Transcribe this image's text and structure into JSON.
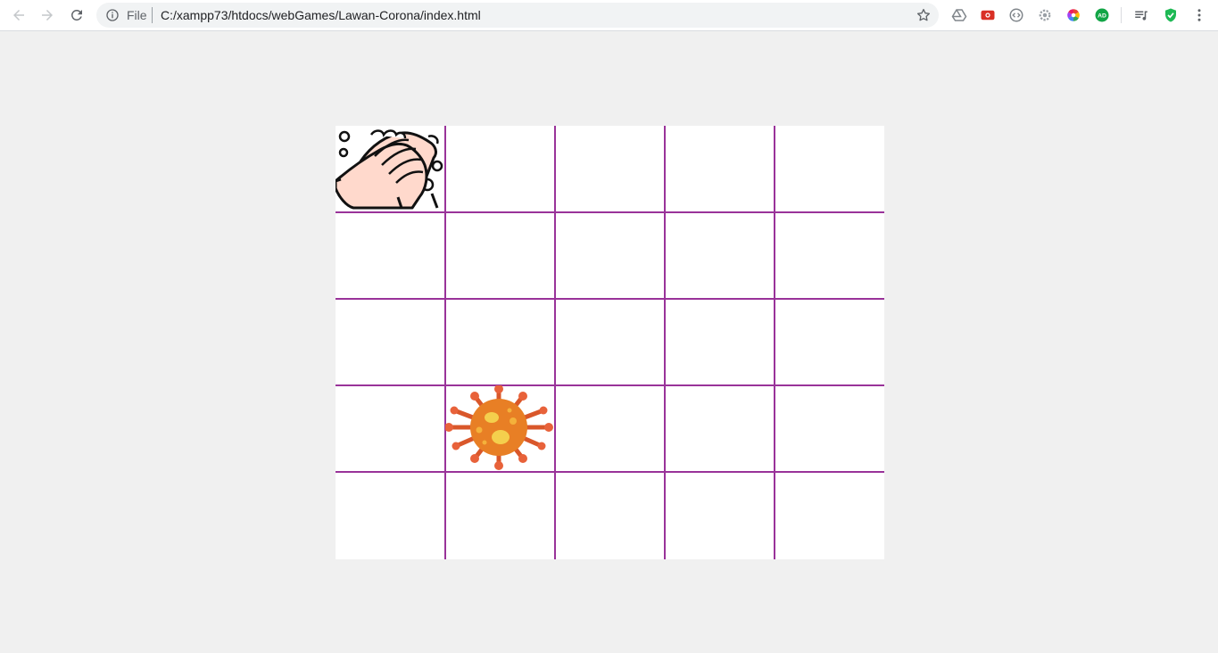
{
  "browser": {
    "scheme_label": "File",
    "url": "C:/xampp73/htdocs/webGames/Lawan-Corona/index.html",
    "icons": {
      "back": "back-arrow-icon",
      "forward": "forward-arrow-icon",
      "reload": "reload-icon",
      "info": "info-icon",
      "bookmark": "star-icon",
      "menu": "three-dot-menu-icon"
    },
    "extensions": [
      "drive-extension-icon",
      "red-extension-icon",
      "code-extension-icon",
      "gear-extension-icon",
      "color-wheel-extension-icon",
      "adguard-extension-icon",
      "playlist-extension-icon",
      "shield-check-extension-icon"
    ],
    "extension_badge_ad": "AD"
  },
  "game": {
    "rows": 5,
    "cols": 5,
    "grid_color": "#993399",
    "player": {
      "name": "hand-washing",
      "row": 0,
      "col": 0
    },
    "virus": {
      "name": "corona-virus",
      "row": 3,
      "col": 1
    }
  }
}
